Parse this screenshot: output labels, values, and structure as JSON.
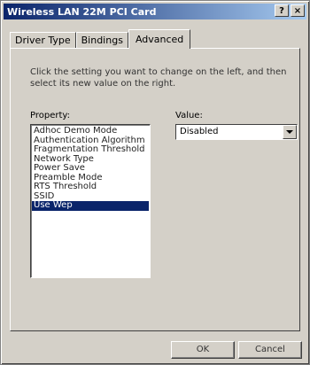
{
  "window": {
    "title": "Wireless LAN 22M PCI Card",
    "help_label": "?",
    "close_label": "×"
  },
  "tabs": [
    {
      "label": "Driver Type"
    },
    {
      "label": "Bindings"
    },
    {
      "label": "Advanced"
    }
  ],
  "active_tab": "Advanced",
  "advanced": {
    "instructions": "Click the setting you want to change on the left, and then select its new value on the right.",
    "property_label": "Property:",
    "value_label": "Value:",
    "properties": [
      {
        "label": "Adhoc Demo Mode"
      },
      {
        "label": "Authentication Algorithm"
      },
      {
        "label": "Fragmentation Threshold"
      },
      {
        "label": "Network Type"
      },
      {
        "label": "Power Save"
      },
      {
        "label": "Preamble Mode"
      },
      {
        "label": "RTS Threshold"
      },
      {
        "label": "SSID"
      },
      {
        "label": "Use Wep"
      }
    ],
    "selected_property": "Use Wep",
    "value_selected": "Disabled"
  },
  "buttons": {
    "ok": "OK",
    "cancel": "Cancel"
  },
  "colors": {
    "selection": "#0a246a",
    "dialog_face": "#d4d0c8"
  }
}
